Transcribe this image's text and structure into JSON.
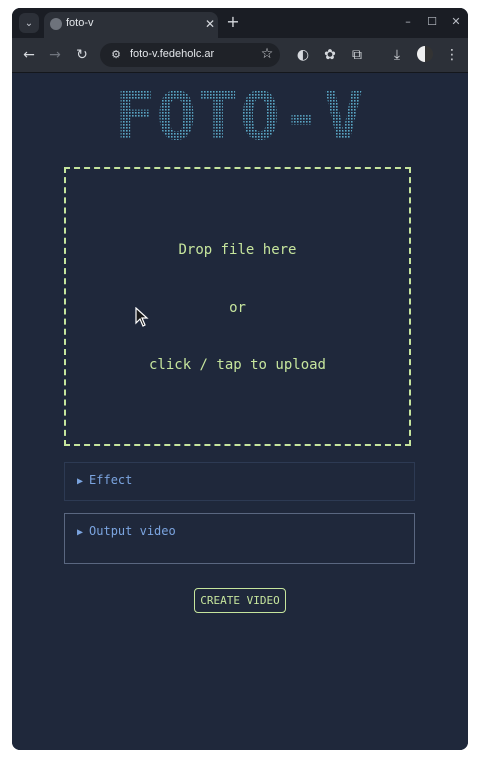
{
  "browser": {
    "tab_title": "foto-v",
    "tab_close": "✕",
    "new_tab": "+",
    "url": "foto-v.fedeholc.ar",
    "window_controls": [
      "–",
      "☐",
      "✕"
    ]
  },
  "app": {
    "logo_text": "FOTO-V",
    "dropzone": {
      "line1": "Drop file here",
      "line2": "or",
      "line3": "click / tap to upload"
    },
    "panels": [
      {
        "label": "Effect",
        "expanded": false
      },
      {
        "label": "Output video",
        "expanded": false
      }
    ],
    "create_button": "CREATE VIDEO"
  },
  "colors": {
    "accent_green": "#c6e59d",
    "panel_text_blue": "#7ba4df",
    "page_background": "#1f283b"
  },
  "icons": [
    "tab-search-icon",
    "globe-icon",
    "back-arrow-icon",
    "forward-arrow-icon",
    "reload-icon",
    "site-info-icon",
    "star-icon",
    "extension-icon",
    "download-icon",
    "menu-icon",
    "cursor-icon"
  ]
}
